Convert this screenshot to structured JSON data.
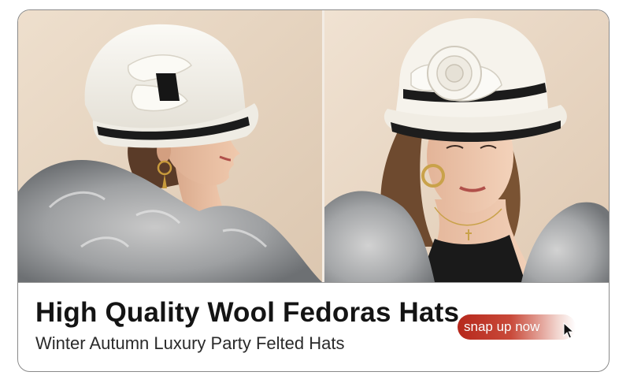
{
  "banner": {
    "headline": "High Quality Wool Fedoras Hats",
    "subline": "Winter Autumn Luxury Party Felted Hats",
    "cta_label": "snap up now"
  },
  "icons": {
    "cursor": "mouse-pointer-icon"
  },
  "colors": {
    "background": "#ffffff",
    "photo_backdrop": "#e9d8c4",
    "hat": "#f4f1ea",
    "cta_red": "#b6281c",
    "headline": "#141414"
  }
}
